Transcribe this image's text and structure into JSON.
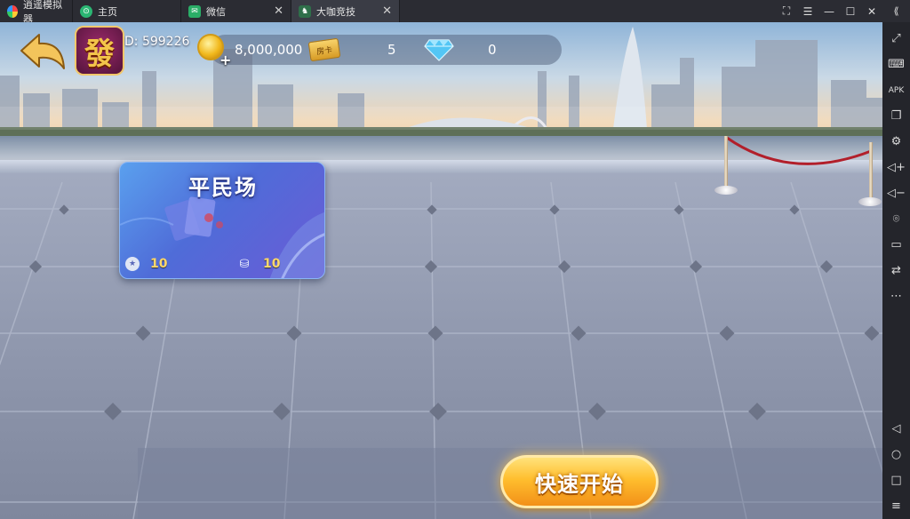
{
  "tabs": [
    {
      "label": "逍遥模拟器",
      "icon": "emulator-logo-icon"
    },
    {
      "label": "主页",
      "icon": "home-icon"
    },
    {
      "label": "微信",
      "icon": "wechat-icon"
    },
    {
      "label": "大咖竞技",
      "icon": "game-icon",
      "active": true
    }
  ],
  "window_controls": [
    "fullscreen-icon",
    "menu-icon",
    "minimize-icon",
    "maximize-icon",
    "close-icon"
  ],
  "sidebar": {
    "top": [
      "collapse-icon",
      "keyboard-icon",
      "apk-install-icon",
      "multi-window-icon",
      "settings-icon",
      "volume-up-icon",
      "volume-down-icon",
      "location-icon",
      "folder-icon",
      "rotate-icon",
      "more-icon"
    ],
    "bottom": [
      "android-back-icon",
      "android-home-icon",
      "android-recent-icon",
      "android-menu-icon"
    ]
  },
  "header": {
    "id_label": "D: 599226",
    "gold": "8,000,000",
    "tickets": "5",
    "diamonds": "0",
    "avatar_glyph": "發",
    "ticket_glyph": "房卡"
  },
  "room_card": {
    "title": "平民场",
    "level": "10",
    "base_score": "10"
  },
  "quick_start_label": "快速开始",
  "colors": {
    "accent_gold": "#ffbe2e",
    "card_blue": "#4f6cd8",
    "chrome_dark": "#2b2c33"
  }
}
